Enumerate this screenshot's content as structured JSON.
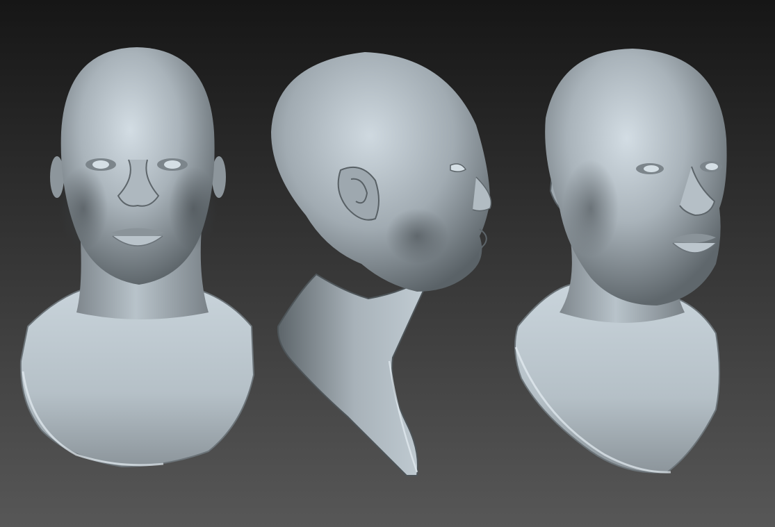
{
  "scene": {
    "description_visible_text": "",
    "background": {
      "top_color": "#161616",
      "bottom_color": "#575757"
    },
    "material": {
      "highlight_color": "#d9e4ec",
      "mid_color": "#a9b4bc",
      "shadow_color": "#3b4145",
      "rim_color": "#e8f0f5"
    },
    "views": [
      {
        "name": "front-view",
        "orientation": "front"
      },
      {
        "name": "side-view",
        "orientation": "right-profile"
      },
      {
        "name": "three-quarter-view",
        "orientation": "three-quarter"
      }
    ]
  }
}
